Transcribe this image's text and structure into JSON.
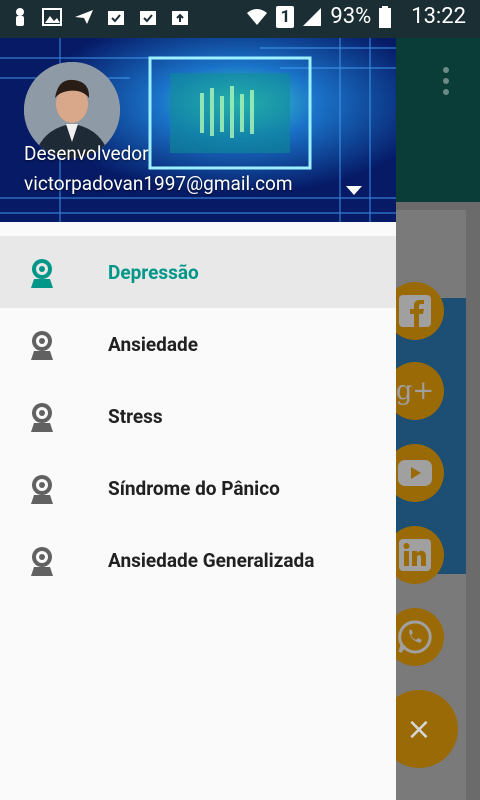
{
  "status_bar": {
    "battery": "93%",
    "time": "13:22",
    "sim_badge": "1"
  },
  "drawer": {
    "header": {
      "name": "Desenvolvedor",
      "email": "victorpadovan1997@gmail.com"
    },
    "menu": [
      {
        "label": "Depressão",
        "selected": true
      },
      {
        "label": "Ansiedade",
        "selected": false
      },
      {
        "label": "Stress",
        "selected": false
      },
      {
        "label": "Síndrome do Pânico",
        "selected": false
      },
      {
        "label": "Ansiedade Generalizada",
        "selected": false
      }
    ]
  },
  "background_app": {
    "fab_symbol": "×",
    "social_icons": [
      "facebook-icon",
      "google-plus-icon",
      "youtube-icon",
      "linkedin-icon",
      "whatsapp-icon"
    ]
  },
  "colors": {
    "accent": "#009688",
    "status_bar": "#1b2e33",
    "social_orange_dimmed": "#9a6a07"
  }
}
